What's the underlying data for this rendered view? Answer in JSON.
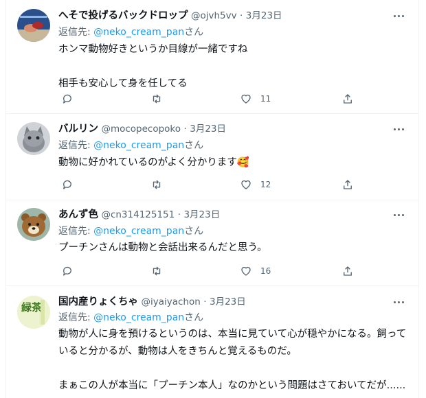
{
  "tweets": [
    {
      "name": "へそで投げるバックドロップ",
      "handle": "@ojvh5vv",
      "sep": "·",
      "time": "3月23日",
      "reply_prefix": "返信先: ",
      "reply_mention": "@neko_cream_pan",
      "reply_suffix": "さん",
      "text": "ホンマ動物好きというか目線が一緒ですね\n\n相手も安心して身を任してる",
      "like_count": "11",
      "avatar": "wrestling-photo-avatar"
    },
    {
      "name": "バルリン",
      "handle": "@mocopecopoko",
      "sep": "·",
      "time": "3月23日",
      "reply_prefix": "返信先: ",
      "reply_mention": "@neko_cream_pan",
      "reply_suffix": "さん",
      "text": "動物に好かれているのがよく分かります🥰",
      "like_count": "12",
      "avatar": "cat-photo-avatar"
    },
    {
      "name": "あんず色",
      "handle": "@cn314125151",
      "sep": "·",
      "time": "3月23日",
      "reply_prefix": "返信先: ",
      "reply_mention": "@neko_cream_pan",
      "reply_suffix": "さん",
      "text": "プーチンさんは動物と会話出来るんだと思う。",
      "like_count": "16",
      "avatar": "bear-character-avatar"
    },
    {
      "name": "国内産りょくちゃ",
      "handle": "@iyaiyachon",
      "sep": "·",
      "time": "3月23日",
      "reply_prefix": "返信先: ",
      "reply_mention": "@neko_cream_pan",
      "reply_suffix": "さん",
      "text": "動物が人に身を預けるというのは、本当に見ていて心が穏やかになる。飼っていると分かるが、動物は人をきちんと覚えるものだ。\n\nまぁこの人が本当に「プーチン本人」なのかという問題はさておいてだが......",
      "like_count": "",
      "avatar": "green-tea-avatar",
      "avatar_text": "緑茶"
    }
  ],
  "colors": {
    "accent": "#1d9bf0",
    "secondary_text": "#536471",
    "border": "#eff3f4"
  }
}
